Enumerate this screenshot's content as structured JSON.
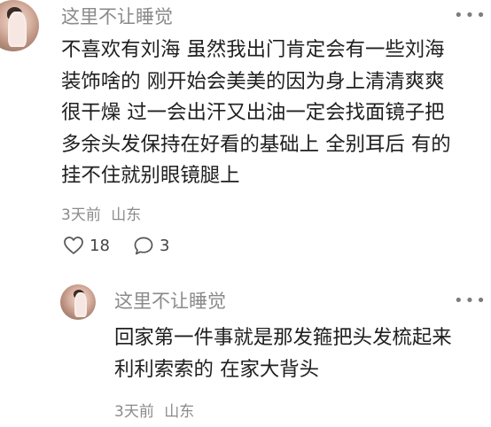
{
  "comment": {
    "username": "这里不让睡觉",
    "lines": [
      "不喜欢有刘海 虽然我出门肯定会有一些刘海",
      "装饰啥的 刚开始会美美的因为身上清清爽爽",
      "很干燥 过一会出汗又出油一定会找面镜子把",
      "多余头发保持在好看的基础上 全别耳后 有的",
      "挂不住就别眼镜腿上"
    ],
    "time": "3天前",
    "location": "山东",
    "likes": "18",
    "replies": "3",
    "more_icon": "more-horizontal-icon",
    "like_icon": "heart-outline-icon",
    "reply_icon": "speech-bubble-icon"
  },
  "reply": {
    "username": "这里不让睡觉",
    "lines": [
      "回家第一件事就是那发箍把头发梳起来",
      "利利索索的 在家大背头"
    ],
    "time": "3天前",
    "location": "山东",
    "more_icon": "more-horizontal-icon"
  }
}
